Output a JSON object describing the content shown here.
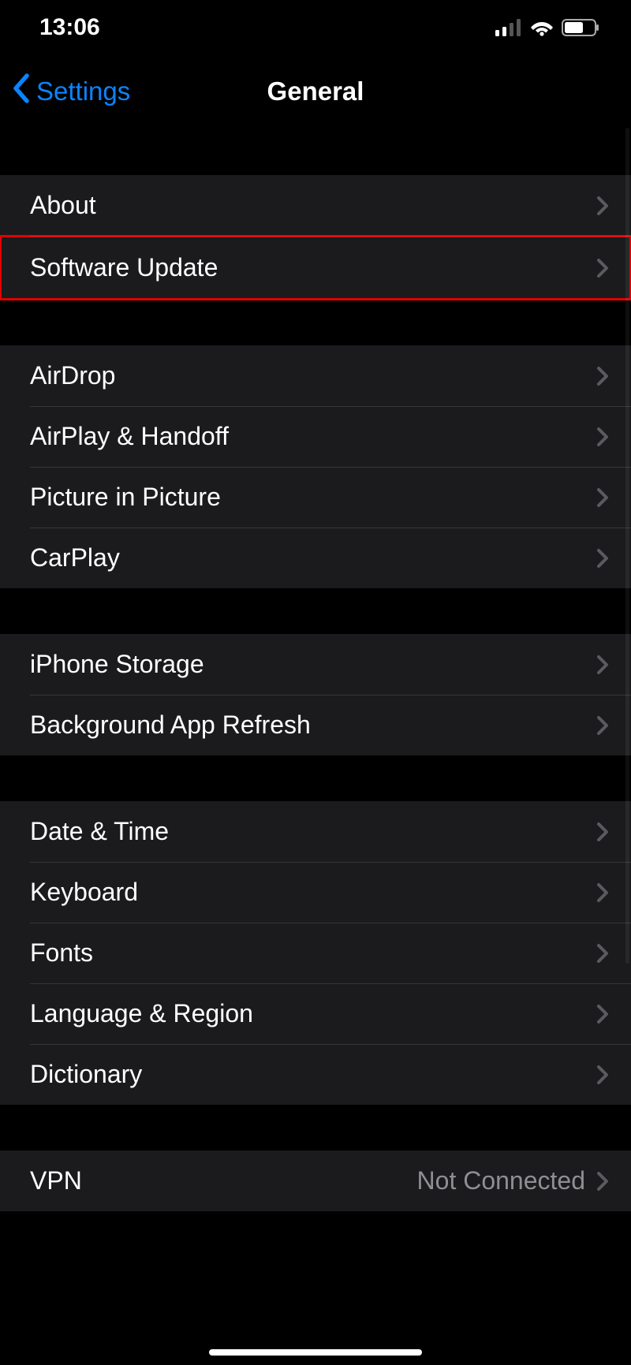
{
  "status": {
    "time": "13:06",
    "cellular_bars": 2,
    "cellular_total_bars": 4,
    "wifi_strength": 3,
    "battery_percent": 60
  },
  "nav": {
    "back_label": "Settings",
    "title": "General"
  },
  "groups": [
    {
      "rows": [
        {
          "id": "about",
          "label": "About",
          "value": "",
          "highlight": false
        },
        {
          "id": "software-update",
          "label": "Software Update",
          "value": "",
          "highlight": true
        }
      ]
    },
    {
      "rows": [
        {
          "id": "airdrop",
          "label": "AirDrop",
          "value": "",
          "highlight": false
        },
        {
          "id": "airplay-handoff",
          "label": "AirPlay & Handoff",
          "value": "",
          "highlight": false
        },
        {
          "id": "pip",
          "label": "Picture in Picture",
          "value": "",
          "highlight": false
        },
        {
          "id": "carplay",
          "label": "CarPlay",
          "value": "",
          "highlight": false
        }
      ]
    },
    {
      "rows": [
        {
          "id": "iphone-storage",
          "label": "iPhone Storage",
          "value": "",
          "highlight": false
        },
        {
          "id": "bg-app-refresh",
          "label": "Background App Refresh",
          "value": "",
          "highlight": false
        }
      ]
    },
    {
      "rows": [
        {
          "id": "date-time",
          "label": "Date & Time",
          "value": "",
          "highlight": false
        },
        {
          "id": "keyboard",
          "label": "Keyboard",
          "value": "",
          "highlight": false
        },
        {
          "id": "fonts",
          "label": "Fonts",
          "value": "",
          "highlight": false
        },
        {
          "id": "language-region",
          "label": "Language & Region",
          "value": "",
          "highlight": false
        },
        {
          "id": "dictionary",
          "label": "Dictionary",
          "value": "",
          "highlight": false
        }
      ]
    },
    {
      "rows": [
        {
          "id": "vpn",
          "label": "VPN",
          "value": "Not Connected",
          "highlight": false
        }
      ]
    }
  ]
}
